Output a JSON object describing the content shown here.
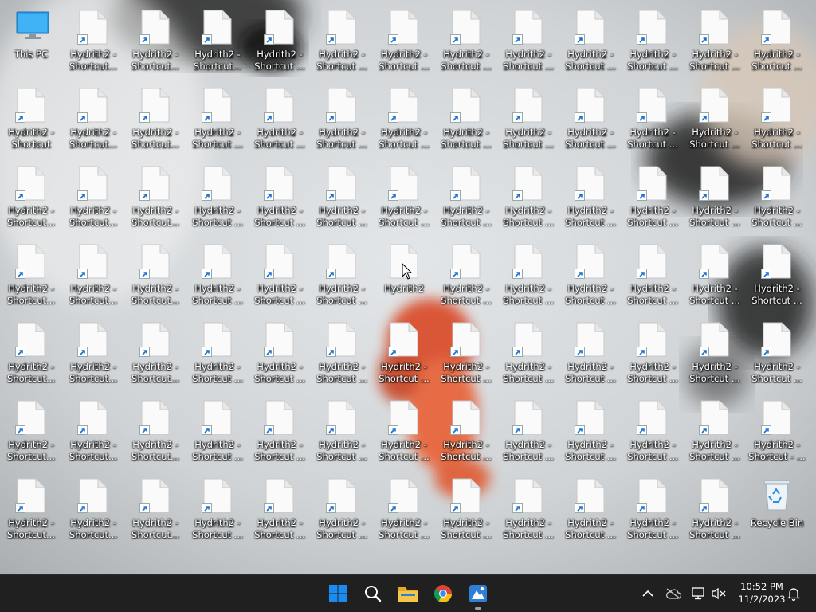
{
  "colors": {
    "taskbar": "#202020",
    "label_text": "#ffffff",
    "windows_blue": "#1a8cf0",
    "fish_orange": "#e05a3a"
  },
  "desktop": {
    "this_pc": {
      "label": "This PC",
      "icon": "computer-monitor-icon"
    },
    "recycle_bin": {
      "label": "Recycle Bin",
      "icon": "recycle-bin-icon"
    },
    "shortcuts": [
      [
        "Hydrith2 -",
        "Shortcut..."
      ],
      [
        "Hydrith2 -",
        "Shortcut..."
      ],
      [
        "Hydrith2 -",
        "Shortcut..."
      ],
      [
        "Hydrith2 -",
        "Shortcut ..."
      ],
      [
        "Hydrith2 -",
        "Shortcut ..."
      ],
      [
        "Hydrith2 -",
        "Shortcut ..."
      ],
      [
        "Hydrith2 -",
        "Shortcut ..."
      ],
      [
        "Hydrith2 -",
        "Shortcut ..."
      ],
      [
        "Hydrith2 -",
        "Shortcut ..."
      ],
      [
        "Hydrith2 -",
        "Shortcut ..."
      ],
      [
        "Hydrith2 -",
        "Shortcut ..."
      ],
      [
        "Hydrith2 -",
        "Shortcut ..."
      ],
      [
        "Hydrith2 -",
        "Shortcut"
      ],
      [
        "Hydrith2 -",
        "Shortcut..."
      ],
      [
        "Hydrith2 -",
        "Shortcut..."
      ],
      [
        "Hydrith2 -",
        "Shortcut ..."
      ],
      [
        "Hydrith2 -",
        "Shortcut ..."
      ],
      [
        "Hydrith2 -",
        "Shortcut ..."
      ],
      [
        "Hydrith2 -",
        "Shortcut ..."
      ],
      [
        "Hydrith2 -",
        "Shortcut ..."
      ],
      [
        "Hydrith2 -",
        "Shortcut ..."
      ],
      [
        "Hydrith2 -",
        "Shortcut ..."
      ],
      [
        "Hydrith2 -",
        "Shortcut ..."
      ],
      [
        "Hydrith2 -",
        "Shortcut ..."
      ],
      [
        "Hydrith2 -",
        "Shortcut ..."
      ],
      [
        "Hydrith2 -",
        "Shortcut..."
      ],
      [
        "Hydrith2 -",
        "Shortcut..."
      ],
      [
        "Hydrith2 -",
        "Shortcut..."
      ],
      [
        "Hydrith2 -",
        "Shortcut ..."
      ],
      [
        "Hydrith2 -",
        "Shortcut ..."
      ],
      [
        "Hydrith2 -",
        "Shortcut ..."
      ],
      [
        "Hydrith2 -",
        "Shortcut ..."
      ],
      [
        "Hydrith2 -",
        "Shortcut ..."
      ],
      [
        "Hydrith2 -",
        "Shortcut ..."
      ],
      [
        "Hydrith2 -",
        "Shortcut ..."
      ],
      [
        "Hydrith2 -",
        "Shortcut ..."
      ],
      [
        "Hydrith2 -",
        "Shortcut ..."
      ],
      [
        "Hydrith2 -",
        "Shortcut ..."
      ],
      [
        "Hydrith2 -",
        "Shortcut..."
      ],
      [
        "Hydrith2 -",
        "Shortcut..."
      ],
      [
        "Hydrith2 -",
        "Shortcut..."
      ],
      [
        "Hydrith2 -",
        "Shortcut ..."
      ],
      [
        "Hydrith2 -",
        "Shortcut ..."
      ],
      [
        "Hydrith2 -",
        "Shortcut ..."
      ],
      [
        "Hydrith2",
        ""
      ],
      [
        "Hydrith2 -",
        "Shortcut ..."
      ],
      [
        "Hydrith2 -",
        "Shortcut ..."
      ],
      [
        "Hydrith2 -",
        "Shortcut ..."
      ],
      [
        "Hydrith2 -",
        "Shortcut ..."
      ],
      [
        "Hydrith2 -",
        "Shortcut ..."
      ],
      [
        "Hydrith2 -",
        "Shortcut ..."
      ],
      [
        "Hydrith2 -",
        "Shortcut..."
      ],
      [
        "Hydrith2 -",
        "Shortcut..."
      ],
      [
        "Hydrith2 -",
        "Shortcut..."
      ],
      [
        "Hydrith2 -",
        "Shortcut ..."
      ],
      [
        "Hydrith2 -",
        "Shortcut ..."
      ],
      [
        "Hydrith2 -",
        "Shortcut ..."
      ],
      [
        "Hydrith2 -",
        "Shortcut ..."
      ],
      [
        "Hydrith2 -",
        "Shortcut ..."
      ],
      [
        "Hydrith2 -",
        "Shortcut ..."
      ],
      [
        "Hydrith2 -",
        "Shortcut ..."
      ],
      [
        "Hydrith2 -",
        "Shortcut ..."
      ],
      [
        "Hydrith2 -",
        "Shortcut ..."
      ],
      [
        "Hydrith2 -",
        "Shortcut ..."
      ],
      [
        "Hydrith2 -",
        "Shortcut..."
      ],
      [
        "Hydrith2 -",
        "Shortcut..."
      ],
      [
        "Hydrith2 -",
        "Shortcut..."
      ],
      [
        "Hydrith2 -",
        "Shortcut ..."
      ],
      [
        "Hydrith2 -",
        "Shortcut ..."
      ],
      [
        "Hydrith2 -",
        "Shortcut ..."
      ],
      [
        "Hydrith2 -",
        "Shortcut ..."
      ],
      [
        "Hydrith2 -",
        "Shortcut ..."
      ],
      [
        "Hydrith2 -",
        "Shortcut ..."
      ],
      [
        "Hydrith2 -",
        "Shortcut ..."
      ],
      [
        "Hydrith2 -",
        "Shortcut ..."
      ],
      [
        "Hydrith2 -",
        "Shortcut ..."
      ],
      [
        "Hydrith2 -",
        "Shortcut - ..."
      ],
      [
        "Hydrith2 -",
        "Shortcut..."
      ],
      [
        "Hydrith2 -",
        "Shortcut..."
      ],
      [
        "Hydrith2 -",
        "Shortcut..."
      ],
      [
        "Hydrith2 -",
        "Shortcut ..."
      ],
      [
        "Hydrith2 -",
        "Shortcut ..."
      ],
      [
        "Hydrith2 -",
        "Shortcut ..."
      ],
      [
        "Hydrith2 -",
        "Shortcut ..."
      ],
      [
        "Hydrith2 -",
        "Shortcut ..."
      ],
      [
        "Hydrith2 -",
        "Shortcut ..."
      ],
      [
        "Hydrith2 -",
        "Shortcut ..."
      ],
      [
        "Hydrith2 -",
        "Shortcut ..."
      ],
      [
        "Hydrith2 -",
        "Shortcut ..."
      ]
    ]
  },
  "taskbar": {
    "pinned": [
      {
        "icon": "windows-start-icon"
      },
      {
        "icon": "search-icon"
      },
      {
        "icon": "file-explorer-icon"
      },
      {
        "icon": "chrome-icon"
      },
      {
        "icon": "paint-app-icon"
      }
    ],
    "tray": [
      {
        "icon": "chevron-up-icon"
      },
      {
        "icon": "onedrive-cloud-icon"
      },
      {
        "icon": "network-icon"
      },
      {
        "icon": "volume-muted-icon"
      }
    ],
    "clock": {
      "time": "10:52 PM",
      "date": "11/2/2023"
    },
    "notification_icon": "bell-icon"
  }
}
